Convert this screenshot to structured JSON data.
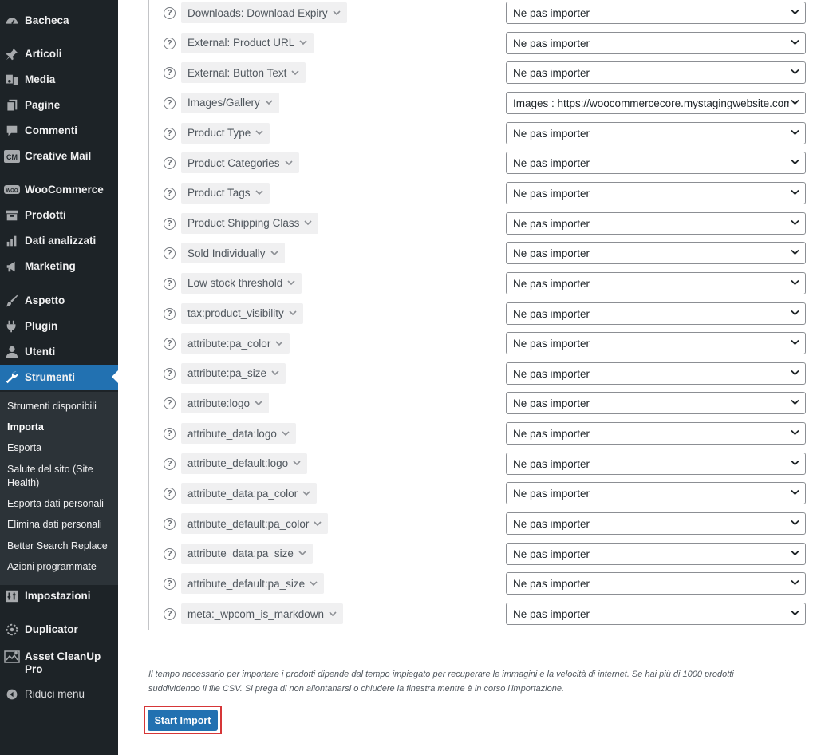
{
  "sidebar": {
    "menu": [
      {
        "label": "Bacheca",
        "icon": "dashboard-icon"
      },
      {
        "label": "Articoli",
        "icon": "pushpin-icon"
      },
      {
        "label": "Media",
        "icon": "media-icon"
      },
      {
        "label": "Pagine",
        "icon": "pages-icon"
      },
      {
        "label": "Commenti",
        "icon": "comments-icon"
      },
      {
        "label": "Creative Mail",
        "icon": "cm-badge-icon"
      },
      {
        "label": "WooCommerce",
        "icon": "woo-icon"
      },
      {
        "label": "Prodotti",
        "icon": "archive-icon"
      },
      {
        "label": "Dati analizzati",
        "icon": "bar-chart-icon"
      },
      {
        "label": "Marketing",
        "icon": "megaphone-icon"
      },
      {
        "label": "Aspetto",
        "icon": "brush-icon"
      },
      {
        "label": "Plugin",
        "icon": "plugin-icon"
      },
      {
        "label": "Utenti",
        "icon": "user-icon"
      },
      {
        "label": "Strumenti",
        "icon": "wrench-icon",
        "active": true
      }
    ],
    "submenu": [
      {
        "label": "Strumenti disponibili"
      },
      {
        "label": "Importa",
        "current": true
      },
      {
        "label": "Esporta"
      },
      {
        "label": "Salute del sito (Site Health)"
      },
      {
        "label": "Esporta dati personali"
      },
      {
        "label": "Elimina dati personali"
      },
      {
        "label": "Better Search Replace"
      },
      {
        "label": "Azioni programmate"
      }
    ],
    "menu_bottom": [
      {
        "label": "Impostazioni",
        "icon": "settings-icon"
      },
      {
        "label": "Duplicator",
        "icon": "duplicator-icon"
      },
      {
        "label": "Asset CleanUp Pro",
        "icon": "asset-cleanup-icon"
      },
      {
        "label": "Riduci menu",
        "icon": "collapse-icon"
      }
    ]
  },
  "mapping": {
    "rows": [
      {
        "column": "Downloads: Download Expiry",
        "field": "Ne pas importer"
      },
      {
        "column": "External: Product URL",
        "field": "Ne pas importer"
      },
      {
        "column": "External: Button Text",
        "field": "Ne pas importer"
      },
      {
        "column": "Images/Gallery",
        "field": "Images   :   https://woocommercecore.mystagingwebsite.com"
      },
      {
        "column": "Product Type",
        "field": "Ne pas importer"
      },
      {
        "column": "Product Categories",
        "field": "Ne pas importer"
      },
      {
        "column": "Product Tags",
        "field": "Ne pas importer"
      },
      {
        "column": "Product Shipping Class",
        "field": "Ne pas importer"
      },
      {
        "column": "Sold Individually",
        "field": "Ne pas importer"
      },
      {
        "column": "Low stock threshold",
        "field": "Ne pas importer"
      },
      {
        "column": "tax:product_visibility",
        "field": "Ne pas importer"
      },
      {
        "column": "attribute:pa_color",
        "field": "Ne pas importer"
      },
      {
        "column": "attribute:pa_size",
        "field": "Ne pas importer"
      },
      {
        "column": "attribute:logo",
        "field": "Ne pas importer"
      },
      {
        "column": "attribute_data:logo",
        "field": "Ne pas importer"
      },
      {
        "column": "attribute_default:logo",
        "field": "Ne pas importer"
      },
      {
        "column": "attribute_data:pa_color",
        "field": "Ne pas importer"
      },
      {
        "column": "attribute_default:pa_color",
        "field": "Ne pas importer"
      },
      {
        "column": "attribute_data:pa_size",
        "field": "Ne pas importer"
      },
      {
        "column": "attribute_default:pa_size",
        "field": "Ne pas importer"
      },
      {
        "column": "meta:_wpcom_is_markdown",
        "field": "Ne pas importer"
      }
    ]
  },
  "note": {
    "line1": "Il tempo necessario per importare i prodotti dipende dal tempo impiegato per recuperare le immagini e la velocità di internet. Se hai più di 1000 prodotti",
    "line2": "suddividendo il file CSV. Si prega di non allontanarsi o chiudere la finestra mentre è in corso l'importazione."
  },
  "actions": {
    "start_import_label": "Start Import"
  },
  "colors": {
    "sidebar_bg": "#1d2327",
    "submenu_bg": "#2c3338",
    "accent": "#2271b1",
    "highlight": "#d63638"
  }
}
